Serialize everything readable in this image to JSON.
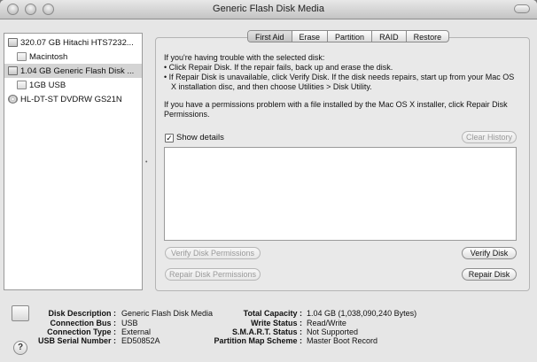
{
  "window": {
    "title": "Generic Flash Disk Media"
  },
  "sidebar": {
    "items": [
      {
        "label": "320.07 GB Hitachi HTS7232...",
        "icon": "hard-disk-icon"
      },
      {
        "label": "Macintosh",
        "icon": "volume-icon"
      },
      {
        "label": "1.04 GB Generic Flash Disk ...",
        "icon": "hard-disk-icon"
      },
      {
        "label": "1GB USB",
        "icon": "volume-icon"
      },
      {
        "label": "HL-DT-ST DVDRW GS21N",
        "icon": "optical-disc-icon"
      }
    ]
  },
  "tabs": [
    {
      "label": "First Aid",
      "active": true
    },
    {
      "label": "Erase"
    },
    {
      "label": "Partition"
    },
    {
      "label": "RAID"
    },
    {
      "label": "Restore"
    }
  ],
  "first_aid": {
    "intro_line1": "If you're having trouble with the selected disk:",
    "intro_line2": "• Click Repair Disk. If the repair fails, back up and erase the disk.",
    "intro_line3": "• If Repair Disk is unavailable, click Verify Disk. If the disk needs repairs, start up from your Mac OS",
    "intro_line4": "X installation disc, and then choose Utilities > Disk Utility.",
    "perm_line1": "If you have a permissions problem with a file installed by the Mac OS X installer, click Repair Disk",
    "perm_line2": "Permissions.",
    "show_details_label": "Show details",
    "show_details_checked": true,
    "check_mark": "✓",
    "clear_history_label": "Clear History",
    "verify_permissions_label": "Verify Disk Permissions",
    "repair_permissions_label": "Repair Disk Permissions",
    "verify_disk_label": "Verify Disk",
    "repair_disk_label": "Repair Disk"
  },
  "info": {
    "left": [
      {
        "label": "Disk Description :",
        "value": "Generic Flash Disk Media"
      },
      {
        "label": "Connection Bus :",
        "value": "USB"
      },
      {
        "label": "Connection Type :",
        "value": "External"
      },
      {
        "label": "USB Serial Number :",
        "value": "ED50852A"
      }
    ],
    "right": [
      {
        "label": "Total Capacity :",
        "value": "1.04 GB (1,038,090,240 Bytes)"
      },
      {
        "label": "Write Status :",
        "value": "Read/Write"
      },
      {
        "label": "S.M.A.R.T. Status :",
        "value": "Not Supported"
      },
      {
        "label": "Partition Map Scheme :",
        "value": "Master Boot Record"
      }
    ]
  },
  "help": {
    "label": "?"
  },
  "colors": {
    "selected_row": "#d4d4d4",
    "window_bg": "#e6e6e6"
  }
}
